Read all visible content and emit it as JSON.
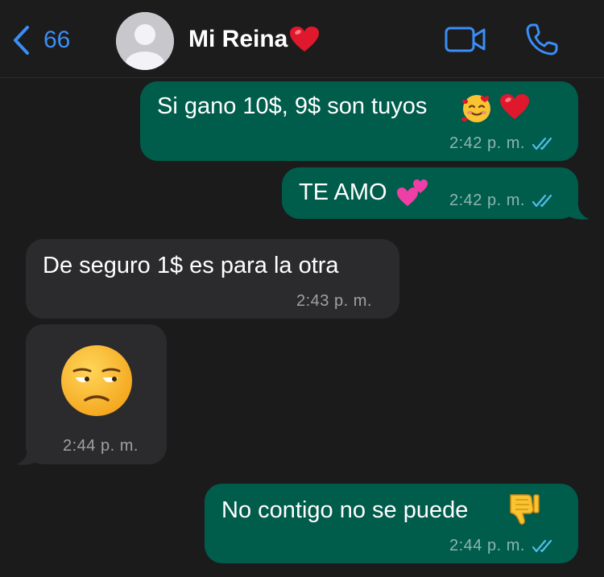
{
  "header": {
    "back_count": "66",
    "contact_name": "Mi Reina",
    "name_emoji": "heart"
  },
  "messages": [
    {
      "direction": "outgoing",
      "text": "Si gano 10$, 9$ son tuyos",
      "emojis": [
        "smiling-face-with-hearts",
        "red-heart"
      ],
      "time": "2:42 p. m.",
      "status": "read"
    },
    {
      "direction": "outgoing",
      "text": "TE AMO",
      "emojis": [
        "two-hearts"
      ],
      "time": "2:42 p. m.",
      "status": "read"
    },
    {
      "direction": "incoming",
      "text": "De seguro 1$ es para la otra",
      "time": "2:43 p. m."
    },
    {
      "direction": "incoming",
      "text": "",
      "emojis": [
        "unamused-face"
      ],
      "time": "2:44 p. m."
    },
    {
      "direction": "outgoing",
      "text": "No contigo no se puede",
      "emojis": [
        "thumbs-down"
      ],
      "time": "2:44 p. m.",
      "status": "read"
    }
  ],
  "colors": {
    "background": "#1b1b1c",
    "outgoing_bubble": "#005c4b",
    "incoming_bubble": "#2b2b2d",
    "accent": "#3a8ef6",
    "read_ticks": "#53bdeb"
  }
}
